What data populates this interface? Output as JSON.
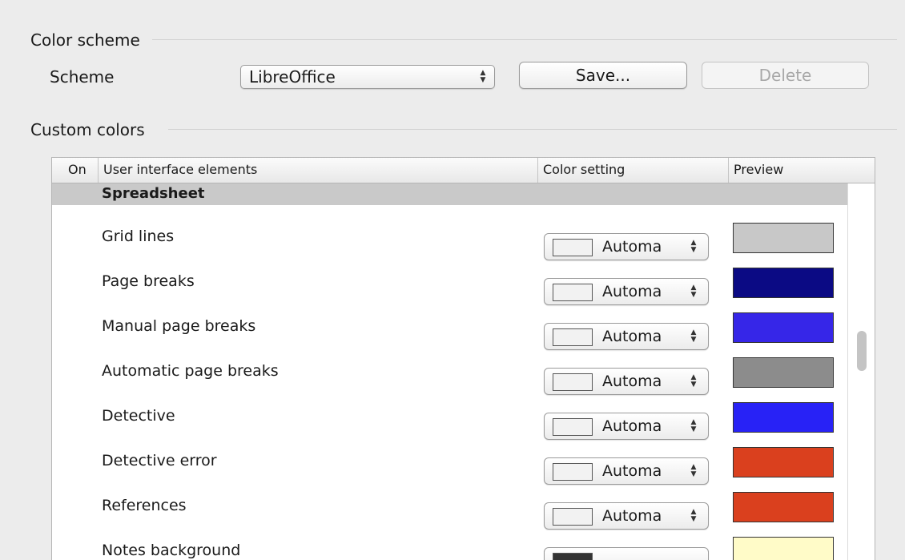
{
  "color_scheme": {
    "section_title": "Color scheme",
    "scheme_label": "Scheme",
    "scheme_value": "LibreOffice",
    "save_label": "Save...",
    "delete_label": "Delete"
  },
  "custom_colors": {
    "section_title": "Custom colors",
    "columns": {
      "on": "On",
      "elements": "User interface elements",
      "color_setting": "Color setting",
      "preview": "Preview"
    },
    "group": "Spreadsheet",
    "rows": [
      {
        "label": "Grid lines",
        "setting": "Automa",
        "preview_color": "#c8c8c8"
      },
      {
        "label": "Page breaks",
        "setting": "Automa",
        "preview_color": "#0b0a84"
      },
      {
        "label": "Manual page breaks",
        "setting": "Automa",
        "preview_color": "#3626e8"
      },
      {
        "label": "Automatic page breaks",
        "setting": "Automa",
        "preview_color": "#8c8c8c"
      },
      {
        "label": "Detective",
        "setting": "Automa",
        "preview_color": "#2822f6"
      },
      {
        "label": "Detective error",
        "setting": "Automa",
        "preview_color": "#da401e"
      },
      {
        "label": "References",
        "setting": "Automa",
        "preview_color": "#da401e"
      },
      {
        "label": "Notes background",
        "setting": "",
        "preview_color": "#fffbc8"
      }
    ]
  }
}
